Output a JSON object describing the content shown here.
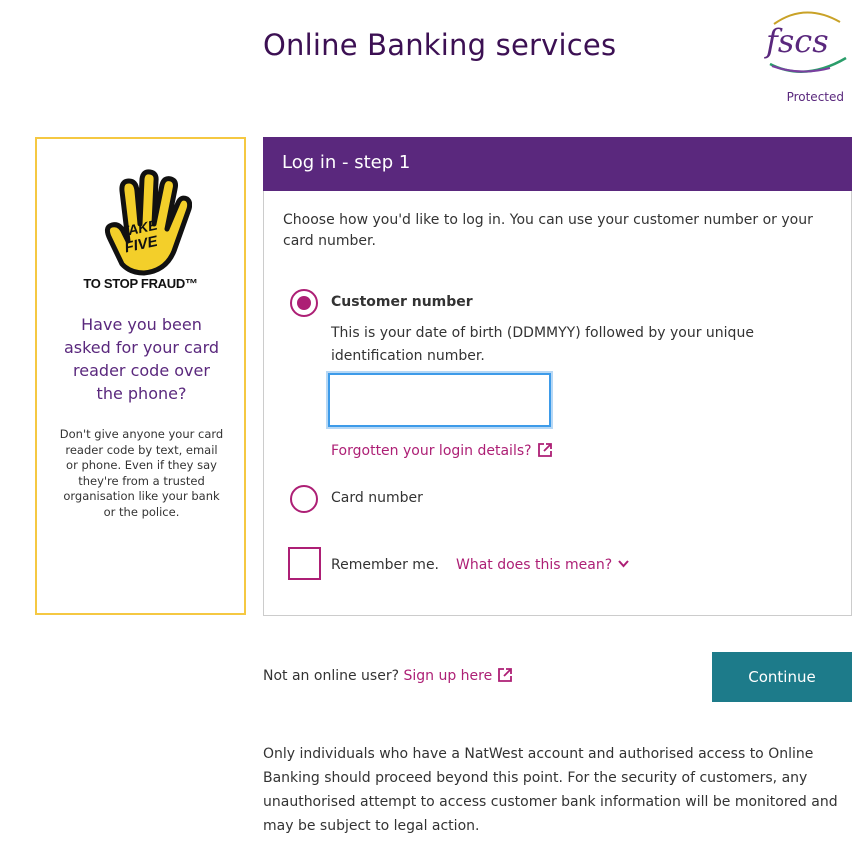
{
  "header": {
    "title": "Online Banking services",
    "fscs_logo_text": "fscs",
    "fscs_sub": "Protected"
  },
  "fraud_panel": {
    "logo_line1": "TAKE",
    "logo_line2": "FIVE",
    "heading": "TO STOP FRAUD™",
    "question": "Have you been asked for your card reader code over the phone?",
    "body": "Don't give anyone your card reader code by text, email or phone. Even if they say they're from a trusted organisation like your bank or the police."
  },
  "login": {
    "header": "Log in - step 1",
    "intro": "Choose how you'd like to log in. You can use your customer number or your card number.",
    "customer_number_label": "Customer number",
    "customer_number_help": "This is your date of birth (DDMMYY) followed by your unique identification number.",
    "customer_number_value": "",
    "forgot_link": "Forgotten your login details?",
    "card_number_label": "Card number",
    "remember_label": "Remember me.",
    "what_link": "What does this mean?",
    "selected_option": "customer_number"
  },
  "footer": {
    "not_user_text": "Not an online user?",
    "signup_link": "Sign up here",
    "continue_label": "Continue",
    "disclaimer": "Only individuals who have a NatWest account and authorised access to Online Banking should proceed beyond this point. For the security of customers, any unauthorised attempt to access customer bank information will be monitored and may be subject to legal action."
  },
  "colors": {
    "brand_purple": "#5a287d",
    "link_magenta": "#ad1f75",
    "continue_teal": "#1d7b8a",
    "fraud_border": "#f5c842"
  }
}
